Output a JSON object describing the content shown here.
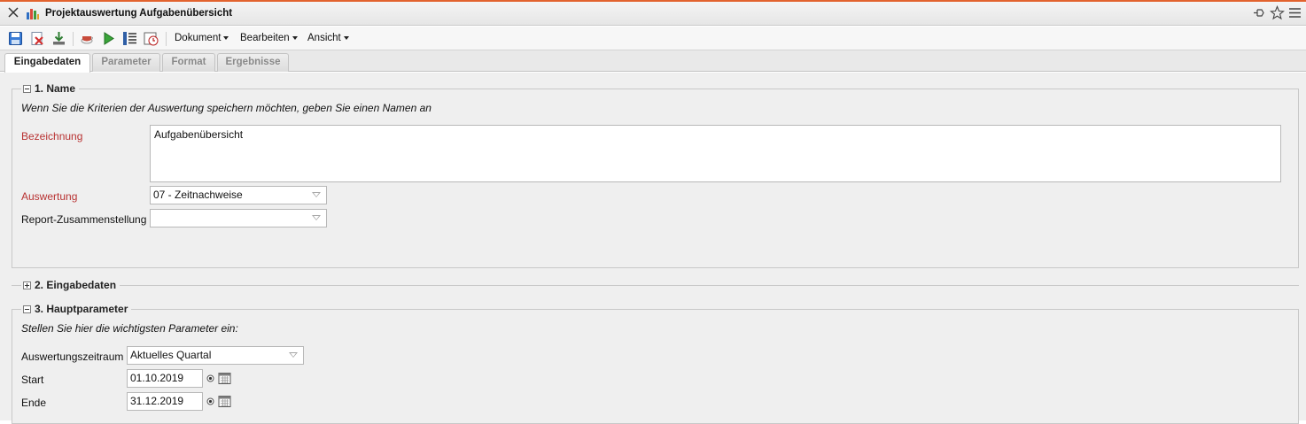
{
  "window": {
    "title": "Projektauswertung Aufgabenübersicht",
    "icons": [
      "close-icon",
      "chart-icon",
      "pin-icon",
      "star-icon",
      "menu-icon"
    ]
  },
  "toolbar": {
    "icons": [
      "save-icon",
      "delete-icon",
      "download-icon",
      "coffee-icon",
      "run-icon",
      "list-icon",
      "schedule-icon"
    ],
    "menus": [
      "Dokument",
      "Bearbeiten",
      "Ansicht"
    ]
  },
  "tabs": [
    "Eingabedaten",
    "Parameter",
    "Format",
    "Ergebnisse"
  ],
  "active_tab": "Eingabedaten",
  "section1": {
    "legend": "1. Name",
    "hint": "Wenn Sie die Kriterien der Auswertung speichern möchten, geben Sie einen Namen an",
    "bezeichnung_label": "Bezeichnung",
    "bezeichnung_value": "Aufgabenübersicht",
    "auswertung_label": "Auswertung",
    "auswertung_value": "07 - Zeitnachweise",
    "report_label": "Report-Zusammenstellung",
    "report_value": ""
  },
  "section2": {
    "legend": "2. Eingabedaten"
  },
  "section3": {
    "legend": "3. Hauptparameter",
    "hint": "Stellen Sie hier die wichtigsten Parameter ein:",
    "zeitraum_label": "Auswertungszeitraum",
    "zeitraum_value": "Aktuelles Quartal",
    "start_label": "Start",
    "start_value": "01.10.2019",
    "ende_label": "Ende",
    "ende_value": "31.12.2019"
  },
  "colors": {
    "accent_line": "#e2632e",
    "required_label": "#b83232",
    "panel_bg": "#efefef"
  }
}
